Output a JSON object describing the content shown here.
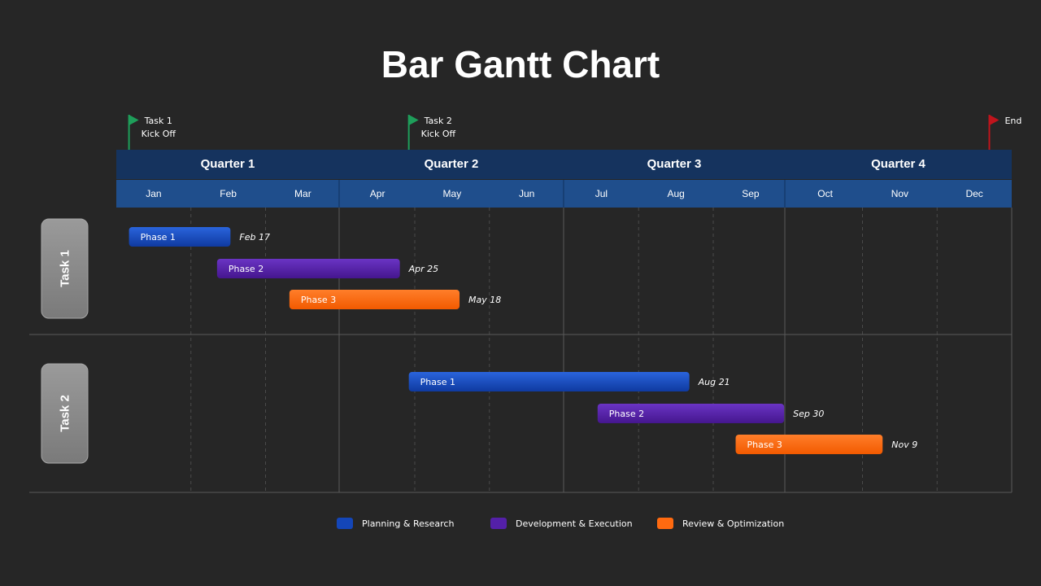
{
  "chart_data": {
    "type": "gantt",
    "title": "Bar Gantt Chart",
    "quarters": [
      "Quarter 1",
      "Quarter 2",
      "Quarter 3",
      "Quarter 4"
    ],
    "months": [
      "Jan",
      "Feb",
      "Mar",
      "Apr",
      "May",
      "Jun",
      "Jul",
      "Aug",
      "Sep",
      "Oct",
      "Nov",
      "Dec"
    ],
    "milestones": [
      {
        "label_line1": "Task 1",
        "label_line2": "Kick Off",
        "month_pos": 0.17,
        "color": "#1e9e5a"
      },
      {
        "label_line1": "Task 2",
        "label_line2": "Kick Off",
        "month_pos": 3.92,
        "color": "#1e9e5a"
      },
      {
        "label_line1": "End",
        "label_line2": "",
        "month_pos": 11.7,
        "color": "#c0141c"
      }
    ],
    "tasks": [
      {
        "label": "Task 1",
        "phases": [
          {
            "name": "Phase 1",
            "category": "planning",
            "start": 0.17,
            "end": 1.53,
            "end_label": "Feb 17"
          },
          {
            "name": "Phase 2",
            "category": "development",
            "start": 1.35,
            "end": 3.8,
            "end_label": "Apr 25"
          },
          {
            "name": "Phase 3",
            "category": "review",
            "start": 2.32,
            "end": 4.6,
            "end_label": "May 18"
          }
        ]
      },
      {
        "label": "Task 2",
        "phases": [
          {
            "name": "Phase 1",
            "category": "planning",
            "start": 3.92,
            "end": 7.68,
            "end_label": "Aug 21"
          },
          {
            "name": "Phase 2",
            "category": "development",
            "start": 6.45,
            "end": 8.95,
            "end_label": "Sep 30"
          },
          {
            "name": "Phase 3",
            "category": "review",
            "start": 8.3,
            "end": 10.27,
            "end_label": "Nov 9"
          }
        ]
      }
    ],
    "legend": [
      {
        "key": "planning",
        "label": "Planning & Research",
        "color": "#1446b8"
      },
      {
        "key": "development",
        "label": "Development & Execution",
        "color": "#5420a8"
      },
      {
        "key": "review",
        "label": "Review & Optimization",
        "color": "#ff6a10"
      }
    ],
    "colors": {
      "background": "#262626",
      "quarter_header": "#15335e",
      "month_header": "#1f4e8c",
      "task_label_box": "#8c8c8c",
      "grid_line": "#5a5a5a"
    }
  }
}
